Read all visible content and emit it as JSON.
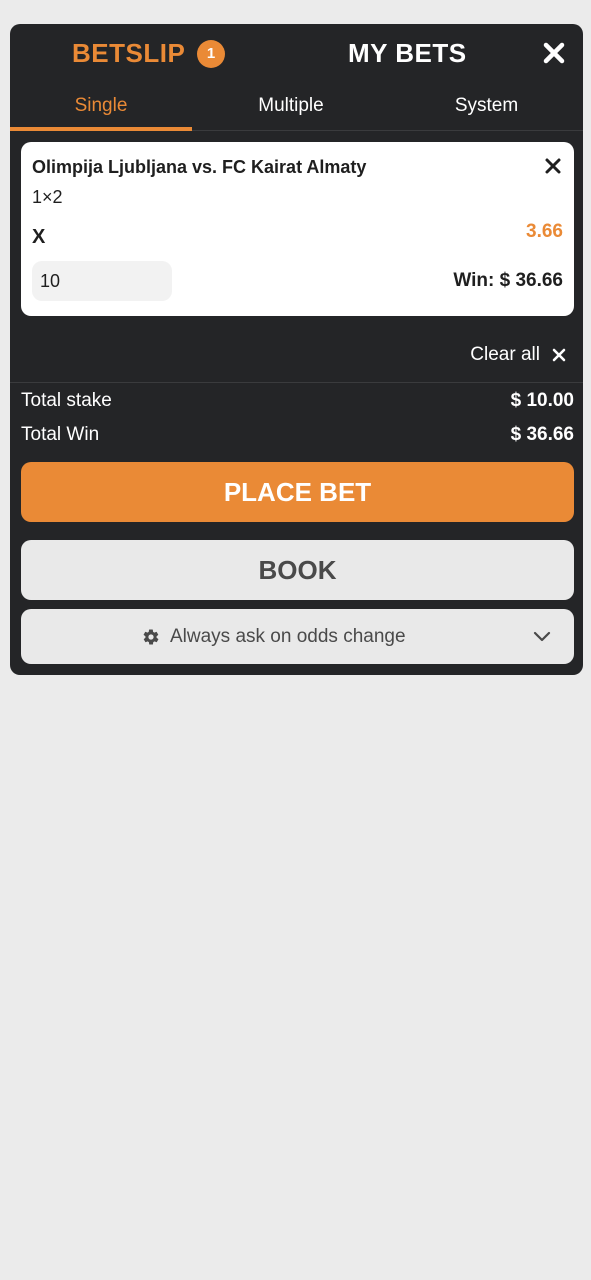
{
  "header": {
    "betslip_title": "BETSLIP",
    "betslip_count": "1",
    "mybets_title": "MY BETS",
    "close_icon": "close-icon"
  },
  "tabs": [
    {
      "label": "Single",
      "active": true
    },
    {
      "label": "Multiple",
      "active": false
    },
    {
      "label": "System",
      "active": false
    }
  ],
  "bet": {
    "match": "Olimpija Ljubljana vs. FC Kairat Almaty",
    "market": "1×2",
    "selection": "X",
    "odds": "3.66",
    "stake": "10",
    "win": "Win: $ 36.66"
  },
  "clear_all_label": "Clear all",
  "totals": {
    "stake_label": "Total stake",
    "stake_value": "$ 10.00",
    "win_label": "Total Win",
    "win_value": "$ 36.66"
  },
  "buttons": {
    "place_bet": "PLACE BET",
    "book": "BOOK",
    "odds_change": "Always ask on odds change"
  },
  "colors": {
    "accent": "#ea8a36",
    "panel": "#242527",
    "background": "#ebebeb"
  }
}
